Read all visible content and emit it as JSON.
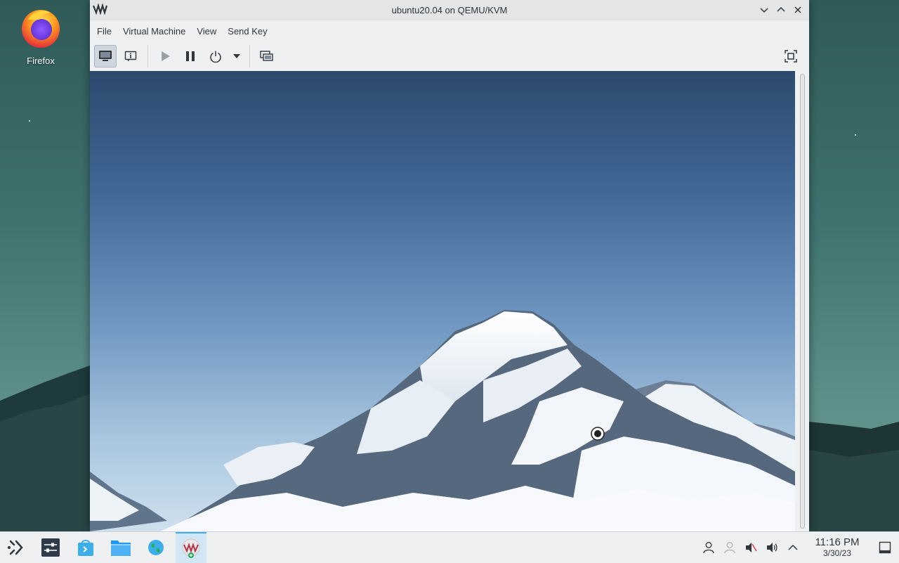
{
  "desktop": {
    "icons": [
      {
        "label": "Firefox",
        "icon": "firefox-icon"
      }
    ]
  },
  "window": {
    "title": "ubuntu20.04 on QEMU/KVM",
    "app_icon": "virt-manager-icon",
    "controls": [
      "minimize-icon",
      "maximize-icon",
      "close-icon"
    ],
    "menu": [
      {
        "label": "File"
      },
      {
        "label": "Virtual Machine"
      },
      {
        "label": "View"
      },
      {
        "label": "Send Key"
      }
    ],
    "toolbar": [
      {
        "name": "console-view-button",
        "icon": "monitor-icon",
        "active": true
      },
      {
        "name": "details-view-button",
        "icon": "info-icon",
        "active": false
      },
      {
        "name": "run-button",
        "icon": "play-icon",
        "active": false
      },
      {
        "name": "pause-button",
        "icon": "pause-icon",
        "active": false
      },
      {
        "name": "shutdown-button",
        "icon": "power-icon",
        "active": false
      },
      {
        "name": "shutdown-menu-button",
        "icon": "dropdown-arrow-icon",
        "active": false
      },
      {
        "name": "snapshots-button",
        "icon": "snapshot-icon",
        "active": false
      },
      {
        "name": "fullscreen-button",
        "icon": "fullscreen-icon",
        "active": false
      }
    ],
    "display": {
      "content": "mountain-wallpaper",
      "cursor": "busy-cursor-icon"
    }
  },
  "taskbar": {
    "launcher": "app-launcher-icon",
    "tasks": [
      {
        "name": "system-settings",
        "icon": "settings-icon"
      },
      {
        "name": "discover",
        "icon": "discover-store-icon"
      },
      {
        "name": "dolphin",
        "icon": "folder-icon"
      },
      {
        "name": "browser",
        "icon": "globe-icon"
      },
      {
        "name": "virt-manager",
        "icon": "virt-manager-icon",
        "active": true
      }
    ],
    "tray": [
      "user-icon",
      "user-switch-icon",
      "mic-muted-icon",
      "volume-icon",
      "expand-tray-icon"
    ],
    "clock": {
      "time": "11:16 PM",
      "date": "3/30/23"
    },
    "show_desktop": "show-desktop-icon"
  },
  "colors": {
    "accent": "#3daee9",
    "panel": "#eff0f1",
    "text": "#31363b"
  }
}
